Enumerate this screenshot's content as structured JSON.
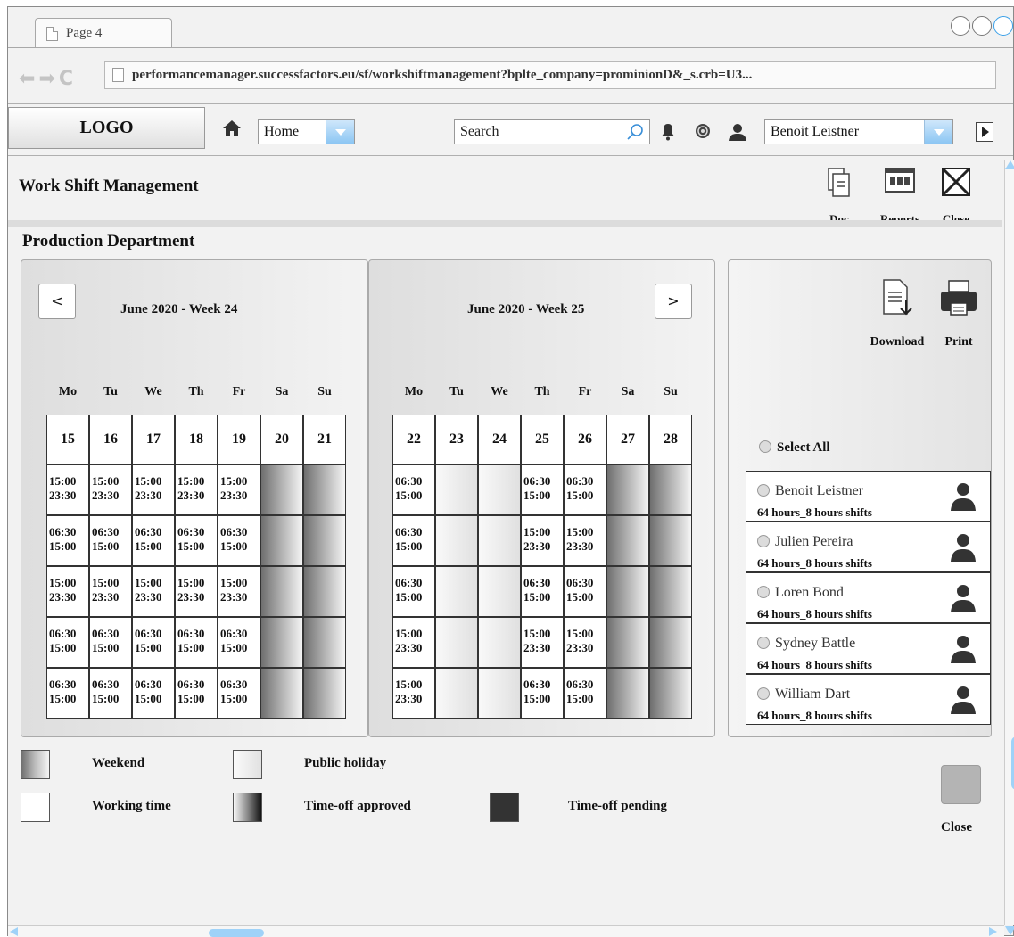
{
  "browser": {
    "tab_title": "Page 4",
    "url": "performancemanager.successfactors.eu/sf/workshiftmanagement?bplte_company=prominionD&_s.crb=U3..."
  },
  "header": {
    "logo": "LOGO",
    "nav_value": "Home",
    "search_placeholder": "Search",
    "user_value": "Benoit Leistner"
  },
  "page": {
    "title": "Work Shift Management",
    "toolbar": {
      "doc": "Doc",
      "reports": "Reports",
      "close": "Close"
    },
    "section": "Production Department"
  },
  "weeks": [
    {
      "title": "June 2020 - Week 24",
      "nav": "<",
      "days": [
        "Mo",
        "Tu",
        "We",
        "Th",
        "Fr",
        "Sa",
        "Su"
      ],
      "dates": [
        "15",
        "16",
        "17",
        "18",
        "19",
        "20",
        "21"
      ],
      "rows": [
        [
          "15:00 23:30",
          "15:00 23:30",
          "15:00 23:30",
          "15:00 23:30",
          "15:00 23:30",
          "weekend",
          "weekend"
        ],
        [
          "06:30 15:00",
          "06:30 15:00",
          "06:30 15:00",
          "06:30 15:00",
          "06:30 15:00",
          "weekend",
          "weekend"
        ],
        [
          "15:00 23:30",
          "15:00 23:30",
          "15:00 23:30",
          "15:00 23:30",
          "15:00 23:30",
          "weekend",
          "weekend"
        ],
        [
          "06:30 15:00",
          "06:30 15:00",
          "06:30 15:00",
          "06:30 15:00",
          "06:30 15:00",
          "weekend",
          "weekend"
        ],
        [
          "06:30 15:00",
          "06:30 15:00",
          "06:30 15:00",
          "06:30 15:00",
          "06:30 15:00",
          "weekend",
          "weekend"
        ]
      ]
    },
    {
      "title": "June 2020 - Week 25",
      "nav": ">",
      "days": [
        "Mo",
        "Tu",
        "We",
        "Th",
        "Fr",
        "Sa",
        "Su"
      ],
      "dates": [
        "22",
        "23",
        "24",
        "25",
        "26",
        "27",
        "28"
      ],
      "rows": [
        [
          "06:30 15:00",
          "holiday",
          "holiday",
          "06:30 15:00",
          "06:30 15:00",
          "weekend",
          "weekend"
        ],
        [
          "06:30 15:00",
          "holiday",
          "holiday",
          "15:00 23:30",
          "15:00 23:30",
          "weekend",
          "weekend"
        ],
        [
          "06:30 15:00",
          "holiday",
          "holiday",
          "06:30 15:00",
          "06:30 15:00",
          "weekend",
          "weekend"
        ],
        [
          "15:00 23:30",
          "holiday",
          "holiday",
          "15:00 23:30",
          "15:00 23:30",
          "weekend",
          "weekend"
        ],
        [
          "15:00 23:30",
          "holiday",
          "holiday",
          "06:30 15:00",
          "06:30 15:00",
          "weekend",
          "weekend"
        ]
      ]
    }
  ],
  "side_panel": {
    "download": "Download",
    "print": "Print",
    "select_all": "Select All",
    "employees": [
      {
        "name": "Benoit Leistner",
        "hours": "64 hours_8 hours shifts"
      },
      {
        "name": "Julien Pereira",
        "hours": "64 hours_8 hours shifts"
      },
      {
        "name": "Loren Bond",
        "hours": "64 hours_8 hours shifts"
      },
      {
        "name": "Sydney Battle",
        "hours": "64 hours_8 hours shifts"
      },
      {
        "name": "William Dart",
        "hours": "64 hours_8 hours shifts"
      }
    ]
  },
  "legend": {
    "weekend": "Weekend",
    "public_holiday": "Public holiday",
    "working_time": "Working time",
    "time_off_approved": "Time-off approved",
    "time_off_pending": "Time-off pending"
  },
  "footer": {
    "close": "Close"
  },
  "colors": {
    "accent": "#8cc6f3",
    "pending": "#333333",
    "scroll_thumb": "#9fd2f8"
  }
}
